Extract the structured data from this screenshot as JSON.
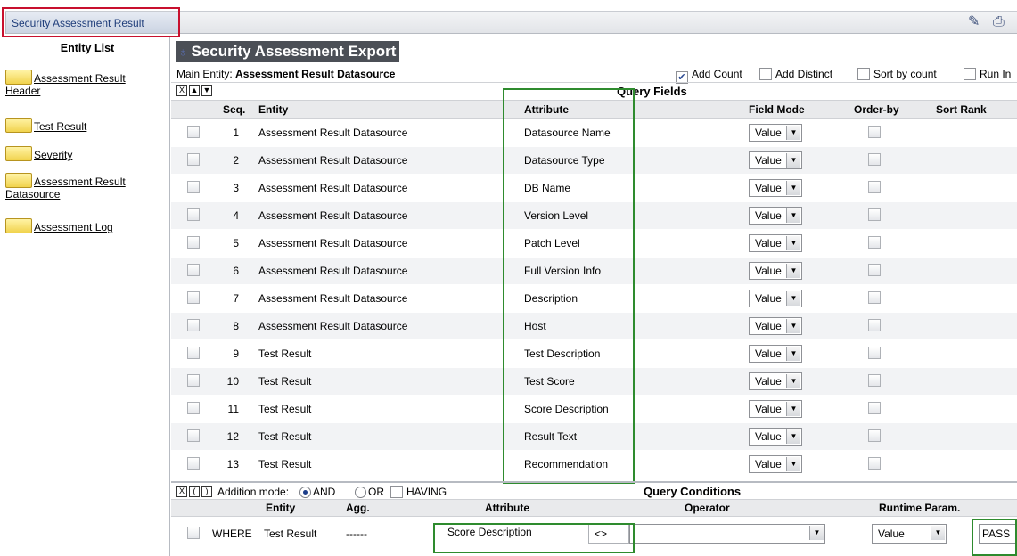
{
  "tab": {
    "label": "Security Assessment Result"
  },
  "toolbar_icons": [
    "edit-icon",
    "print-icon"
  ],
  "entity_list": {
    "title": "Entity List",
    "items": [
      {
        "line1": "Assessment Result",
        "line2": "Header"
      },
      {
        "line1": "Test Result",
        "line2": ""
      },
      {
        "line1": "Severity",
        "line2": ""
      },
      {
        "line1": "Assessment Result",
        "line2": "Datasource"
      },
      {
        "line1": "Assessment Log",
        "line2": ""
      }
    ]
  },
  "export": {
    "title": "Security Assessment Export",
    "main_entity_label": "Main Entity:",
    "main_entity_value": "Assessment Result Datasource",
    "options": {
      "add_count": "Add Count",
      "add_distinct": "Add Distinct",
      "sort_by_count": "Sort by count",
      "run_in": "Run In"
    },
    "add_count_checked": true
  },
  "query_fields": {
    "title": "Query Fields",
    "headers": {
      "seq": "Seq.",
      "entity": "Entity",
      "attribute": "Attribute",
      "field_mode": "Field Mode",
      "order_by": "Order-by",
      "sort_rank": "Sort Rank"
    },
    "rows": [
      {
        "seq": "1",
        "entity": "Assessment Result Datasource",
        "attribute": "Datasource Name",
        "mode": "Value"
      },
      {
        "seq": "2",
        "entity": "Assessment Result Datasource",
        "attribute": "Datasource Type",
        "mode": "Value"
      },
      {
        "seq": "3",
        "entity": "Assessment Result Datasource",
        "attribute": "DB Name",
        "mode": "Value"
      },
      {
        "seq": "4",
        "entity": "Assessment Result Datasource",
        "attribute": "Version Level",
        "mode": "Value"
      },
      {
        "seq": "5",
        "entity": "Assessment Result Datasource",
        "attribute": "Patch Level",
        "mode": "Value"
      },
      {
        "seq": "6",
        "entity": "Assessment Result Datasource",
        "attribute": "Full Version Info",
        "mode": "Value"
      },
      {
        "seq": "7",
        "entity": "Assessment Result Datasource",
        "attribute": "Description",
        "mode": "Value"
      },
      {
        "seq": "8",
        "entity": "Assessment Result Datasource",
        "attribute": "Host",
        "mode": "Value"
      },
      {
        "seq": "9",
        "entity": "Test Result",
        "attribute": "Test Description",
        "mode": "Value"
      },
      {
        "seq": "10",
        "entity": "Test Result",
        "attribute": "Test Score",
        "mode": "Value"
      },
      {
        "seq": "11",
        "entity": "Test Result",
        "attribute": "Score Description",
        "mode": "Value"
      },
      {
        "seq": "12",
        "entity": "Test Result",
        "attribute": "Result Text",
        "mode": "Value"
      },
      {
        "seq": "13",
        "entity": "Test Result",
        "attribute": "Recommendation",
        "mode": "Value"
      }
    ]
  },
  "conditions": {
    "title": "Query Conditions",
    "addition_mode_label": "Addition mode:",
    "modes": {
      "and": "AND",
      "or": "OR",
      "having": "HAVING"
    },
    "headers": {
      "entity": "Entity",
      "agg": "Agg.",
      "attribute": "Attribute",
      "operator": "Operator",
      "runtime_param": "Runtime Param."
    },
    "row": {
      "clause": "WHERE",
      "entity": "Test Result",
      "agg": "------",
      "attribute": "Score Description",
      "operator": "<>",
      "param_mode": "Value",
      "value": "PASS"
    }
  }
}
